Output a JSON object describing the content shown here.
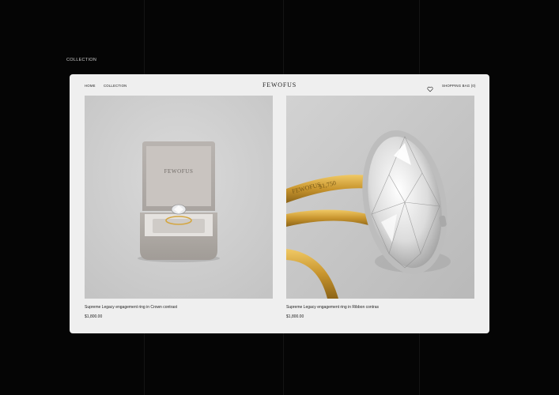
{
  "page": {
    "label": "COLLECTION"
  },
  "nav": {
    "home": "HOME",
    "collection": "COLLECTION",
    "brand": "FEWOFUS",
    "bag": "SHOPPING BAG (0)"
  },
  "products": [
    {
      "title": "Supreme Legacy engagement ring in Crown contrast",
      "price": "$1,800.00",
      "box_brand": "FEWOFUS"
    },
    {
      "title": "Supreme Legacy engagement ring in Ribbon contras",
      "price": "$1,800.00",
      "engraving_brand": "FEWOFUS",
      "engraving_price": "$1,750"
    }
  ],
  "colors": {
    "background": "#050505",
    "panel": "#efefef",
    "gold": "#d4a640",
    "silver": "#c9c9c9"
  },
  "icons": [
    "heart-icon"
  ]
}
